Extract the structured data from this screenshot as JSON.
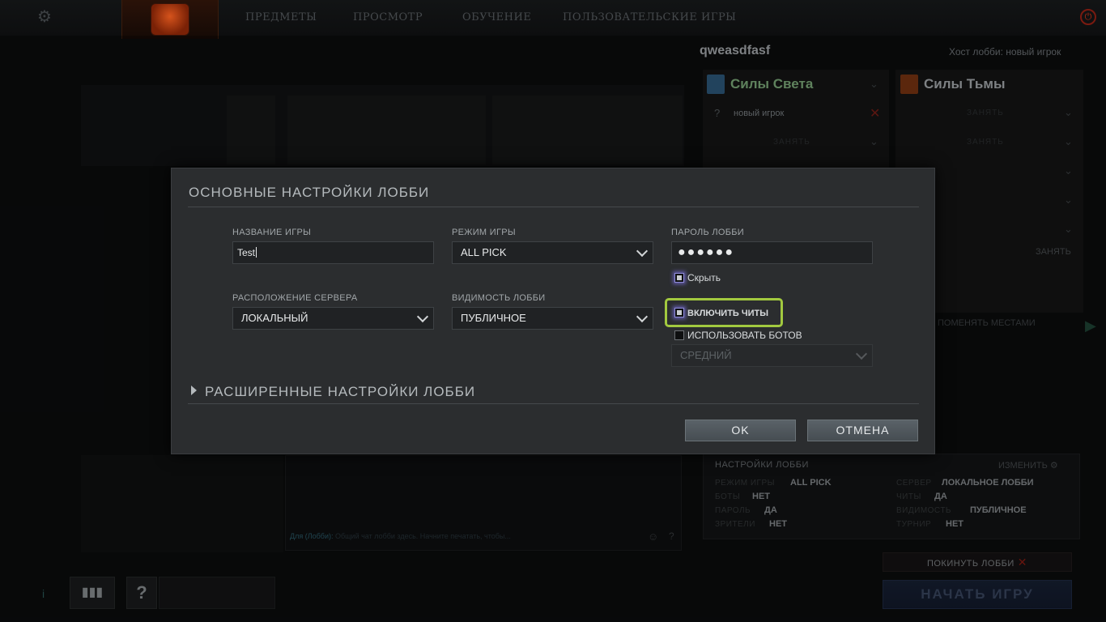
{
  "topnav": {
    "items": [
      "ПРЕДМЕТЫ",
      "ПРОСМОТР",
      "ОБУЧЕНИЕ",
      "ПОЛЬЗОВАТЕЛЬСКИЕ ИГРЫ"
    ]
  },
  "icons": {
    "settings": "gear-icon",
    "power": "power-icon",
    "logo": "dota-logo-icon"
  },
  "lobby": {
    "name": "qweasdfasf",
    "host": "Хост лобби: новый игрок",
    "radiant_title": "Силы Света",
    "dire_title": "Силы Тьмы",
    "player_name": "новый игрок",
    "slot_label": "ЗАНЯТЬ",
    "swap_label": "ПОМЕНЯТЬ МЕСТАМИ",
    "settings": {
      "header": "НАСТРОЙКИ ЛОББИ",
      "change": "ИЗМЕНИТЬ",
      "rows_left": [
        {
          "k": "РЕЖИМ ИГРЫ",
          "v": "ALL PICK"
        },
        {
          "k": "БОТЫ",
          "v": "НЕТ"
        },
        {
          "k": "ПАРОЛЬ",
          "v": "ДА"
        },
        {
          "k": "ЗРИТЕЛИ",
          "v": "НЕТ"
        }
      ],
      "rows_right": [
        {
          "k": "СЕРВЕР",
          "v": "ЛОКАЛЬНОЕ ЛОББИ"
        },
        {
          "k": "ЧИТЫ",
          "v": "ДА"
        },
        {
          "k": "ВИДИМОСТЬ",
          "v": "ПУБЛИЧНОЕ"
        },
        {
          "k": "ТУРНИР",
          "v": "НЕТ"
        }
      ]
    },
    "leave_label": "ПОКИНУТЬ ЛОББИ",
    "start_label": "НАЧАТЬ ИГРУ",
    "chat_channel": "Для (Лобби):",
    "chat_hint": "Общий чат лобби здесь. Начните печатать, чтобы..."
  },
  "dialog": {
    "title": "ОСНОВНЫЕ НАСТРОЙКИ ЛОББИ",
    "game_name_label": "НАЗВАНИЕ ИГРЫ",
    "game_name_value": "Test",
    "game_mode_label": "РЕЖИМ ИГРЫ",
    "game_mode_value": "ALL PICK",
    "password_label": "ПАРОЛЬ ЛОББИ",
    "password_value": "●●●●●●",
    "hide_label": "Скрыть",
    "server_label": "РАСПОЛОЖЕНИЕ СЕРВЕРА",
    "server_value": "ЛОКАЛЬНЫЙ",
    "visibility_label": "ВИДИМОСТЬ ЛОББИ",
    "visibility_value": "ПУБЛИЧНОЕ",
    "cheats_label": "ВКЛЮЧИТЬ ЧИТЫ",
    "bots_label": "ИСПОЛЬЗОВАТЬ БОТОВ",
    "bot_difficulty_value": "СРЕДНИЙ",
    "advanced_label": "РАСШИРЕННЫЕ НАСТРОЙКИ ЛОББИ",
    "ok_label": "OK",
    "cancel_label": "ОТМЕНА"
  },
  "colors": {
    "dialog_bg": "#2b2d2f",
    "highlight": "#a2c93f",
    "radiant": "#7fae7d",
    "dire": "#a9adb0"
  }
}
